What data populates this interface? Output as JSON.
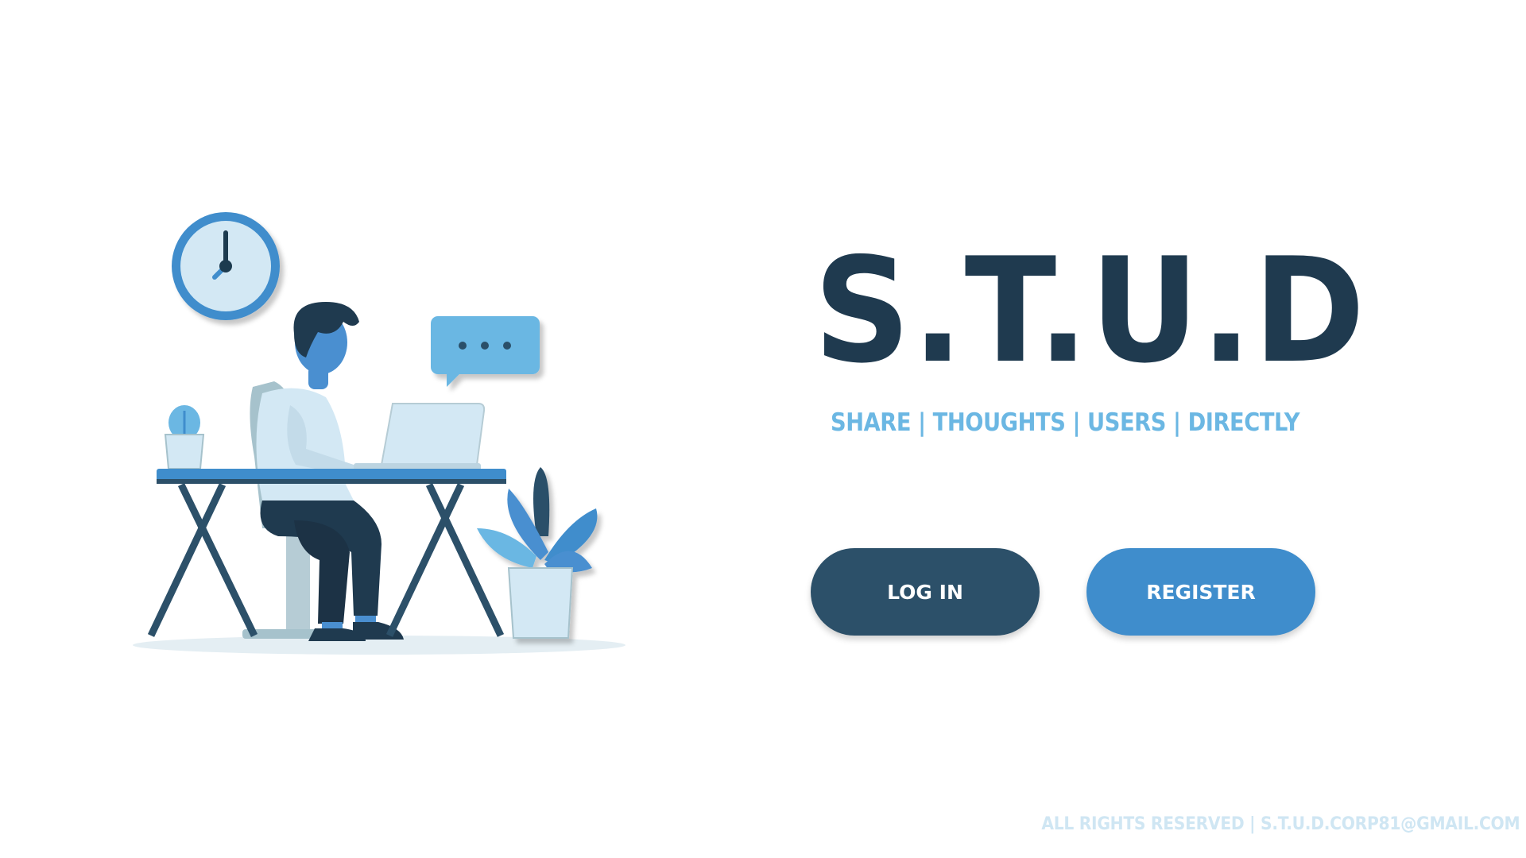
{
  "brand": {
    "title": "S.T.U.D",
    "tagline": "SHARE | THOUGHTS | USERS | DIRECTLY"
  },
  "actions": {
    "login_label": "LOG IN",
    "register_label": "REGISTER"
  },
  "footer": {
    "text": "ALL RIGHTS RESERVED | S.T.U.D.CORP81@GMAIL.COM"
  },
  "illustration": {
    "icons": [
      "clock-icon",
      "chat-bubble-icon",
      "laptop-icon",
      "plant-icon",
      "cactus-icon",
      "person-icon",
      "desk-icon",
      "chair-icon"
    ]
  },
  "colors": {
    "title": "#1f3a4f",
    "tagline": "#6bb7e3",
    "login_button": "#2c5069",
    "register_button": "#3f8dcc",
    "footer": "#cfe6f3"
  }
}
